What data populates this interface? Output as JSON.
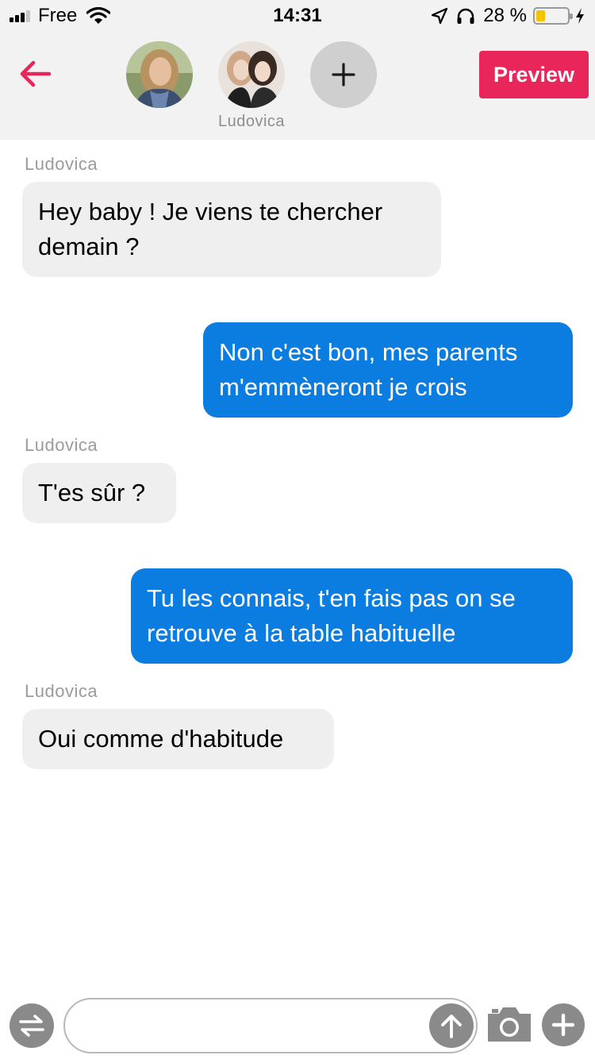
{
  "status_bar": {
    "carrier": "Free",
    "time": "14:31",
    "battery_percent": "28 %",
    "battery_level": 0.28,
    "icons": [
      "signal-icon",
      "wifi-icon",
      "location-icon",
      "headphones-icon",
      "battery-icon",
      "charging-icon"
    ]
  },
  "header": {
    "participant_label": "Ludovica",
    "preview_label": "Preview",
    "icons": [
      "back-arrow-icon",
      "plus-icon"
    ]
  },
  "messages": [
    {
      "direction": "incoming",
      "sender": "Ludovica",
      "text": "Hey baby ! Je viens te chercher demain ?"
    },
    {
      "direction": "outgoing",
      "text": "Non c'est bon, mes parents m'emmèneront je crois"
    },
    {
      "direction": "incoming",
      "sender": "Ludovica",
      "text": "T'es sûr ?"
    },
    {
      "direction": "outgoing",
      "text": "Tu les connais, t'en fais pas on se retrouve à la table habituelle"
    },
    {
      "direction": "incoming",
      "sender": "Ludovica",
      "text": "Oui comme d'habitude"
    }
  ],
  "input_bar": {
    "value": "",
    "placeholder": "",
    "icons": [
      "switch-arrows-icon",
      "send-arrow-icon",
      "camera-icon",
      "plus-icon"
    ]
  },
  "colors": {
    "accent": "#e8265a",
    "outgoing_bubble": "#0b7de0",
    "incoming_bubble": "#efefef",
    "header_background": "#f2f2f2",
    "icon_gray": "#8a8a8a"
  }
}
